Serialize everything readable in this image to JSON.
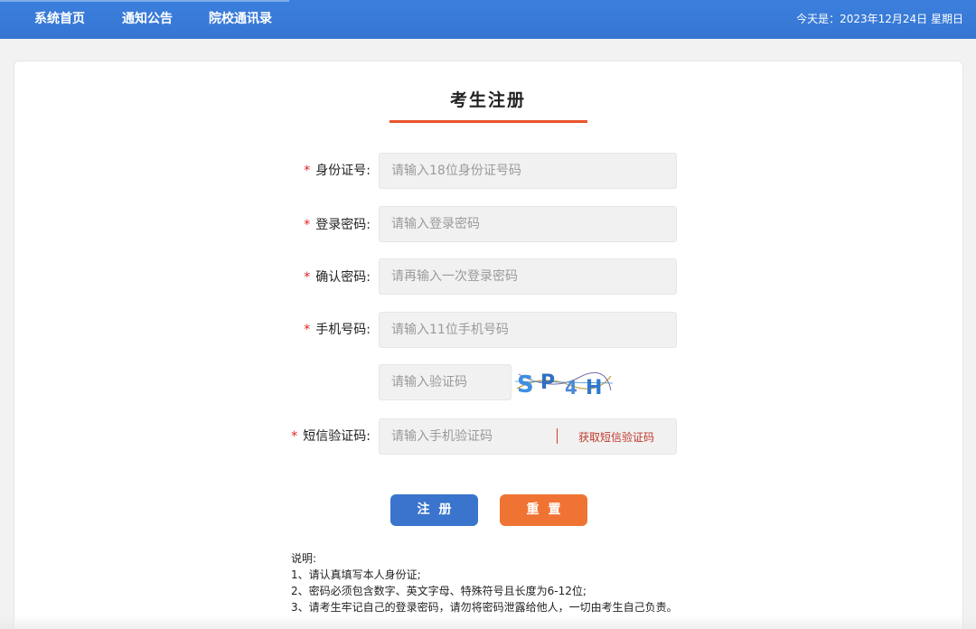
{
  "nav": {
    "items": [
      {
        "label": "系统首页"
      },
      {
        "label": "通知公告"
      },
      {
        "label": "院校通讯录"
      }
    ],
    "date_text": "今天是：2023年12月24日 星期日"
  },
  "page": {
    "title": "考生注册"
  },
  "form": {
    "id_label": "身份证号:",
    "id_placeholder": "请输入18位身份证号码",
    "password_label": "登录密码:",
    "password_placeholder": "请输入登录密码",
    "confirm_label": "确认密码:",
    "confirm_placeholder": "请再输入一次登录密码",
    "phone_label": "手机号码:",
    "phone_placeholder": "请输入11位手机号码",
    "captcha_placeholder": "请输入验证码",
    "captcha_text": "SP4H",
    "sms_label": "短信验证码:",
    "sms_placeholder": "请输入手机验证码",
    "sms_button": "获取短信验证码",
    "required_mark": "*"
  },
  "buttons": {
    "register": "注册",
    "reset": "重置"
  },
  "notes": {
    "heading": "说明:",
    "lines": [
      "1、请认真填写本人身份证;",
      "2、密码必须包含数字、英文字母、特殊符号且长度为6-12位;",
      "3、请考生牢记自己的登录密码，请勿将密码泄露给他人，一切由考生自己负责。"
    ]
  },
  "colors": {
    "topbar": "#3a7bd5",
    "accent": "#e8542a",
    "register_btn": "#3a74cd",
    "reset_btn": "#ef7433"
  }
}
